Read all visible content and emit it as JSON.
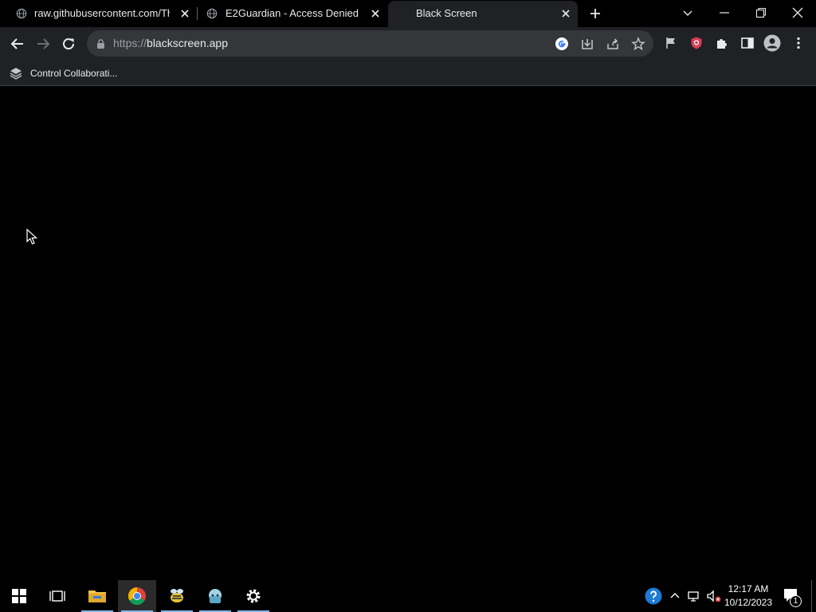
{
  "tabs": [
    {
      "title": "raw.githubusercontent.com/The",
      "active": false
    },
    {
      "title": "E2Guardian - Access Denied",
      "active": false
    },
    {
      "title": "Black Screen",
      "active": true
    }
  ],
  "toolbar": {
    "url_scheme": "https://",
    "url_host": "blackscreen.app"
  },
  "bookmarks": [
    {
      "label": "Control Collaborati..."
    }
  ],
  "taskbar": {
    "apps": [
      "start-button",
      "task-view",
      "file-explorer",
      "chrome",
      "app-bee",
      "app-character",
      "settings"
    ],
    "clock_time": "12:17 AM",
    "clock_date": "10/12/2023",
    "notification_count": "1"
  },
  "colors": {
    "tab_active_bg": "#202124",
    "toolbar_bg": "#202124",
    "omnibox_bg": "#35363a",
    "page_bg": "#000000",
    "accent": "#7eb4ea"
  }
}
